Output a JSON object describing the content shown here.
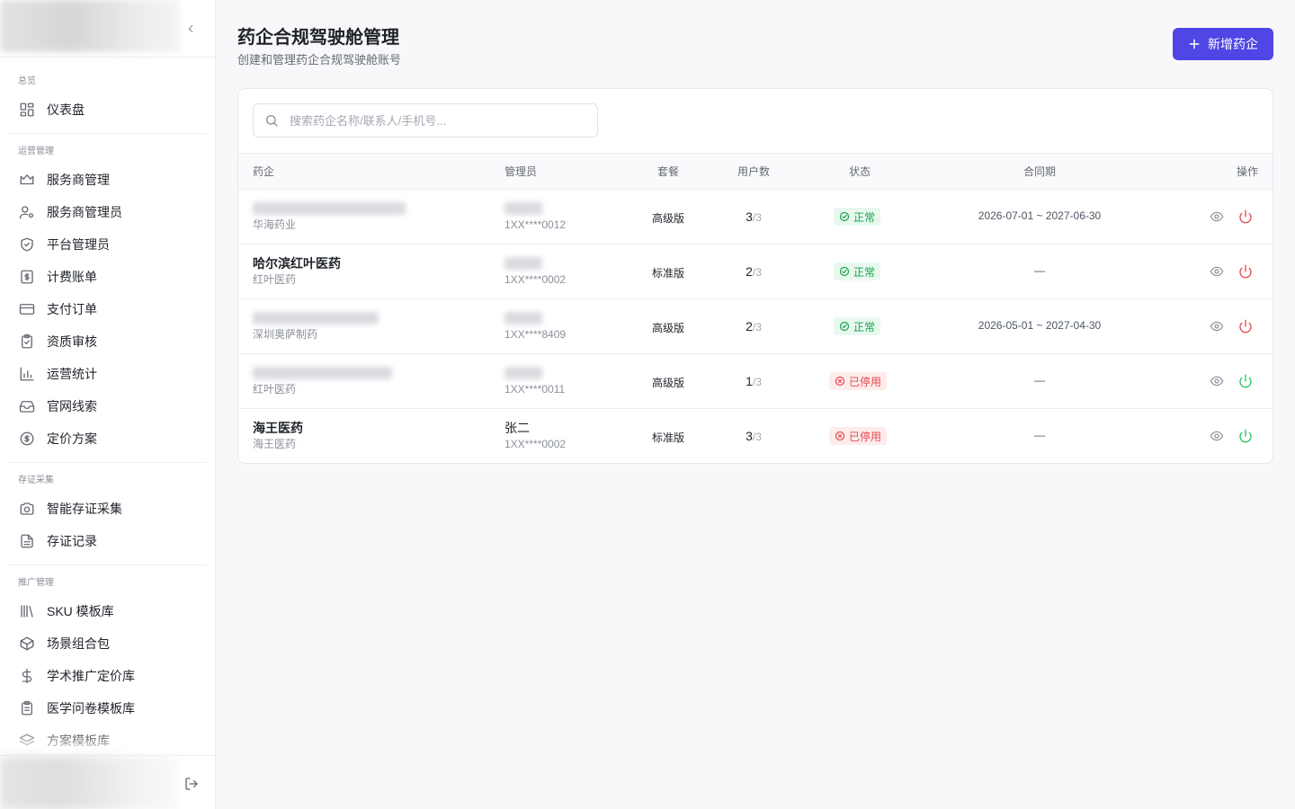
{
  "sidebar": {
    "sections": [
      {
        "title": "总览",
        "items": [
          {
            "label": "仪表盘",
            "icon": "dashboard-icon"
          }
        ]
      },
      {
        "title": "运营管理",
        "items": [
          {
            "label": "服务商管理",
            "icon": "crown-icon"
          },
          {
            "label": "服务商管理员",
            "icon": "user-cog-icon"
          },
          {
            "label": "平台管理员",
            "icon": "shield-check-icon"
          },
          {
            "label": "计费账单",
            "icon": "receipt-dollar-icon"
          },
          {
            "label": "支付订单",
            "icon": "credit-card-icon"
          },
          {
            "label": "资质审核",
            "icon": "clipboard-check-icon"
          },
          {
            "label": "运营统计",
            "icon": "bar-chart-icon"
          },
          {
            "label": "官网线索",
            "icon": "inbox-icon"
          },
          {
            "label": "定价方案",
            "icon": "dollar-circle-icon"
          }
        ]
      },
      {
        "title": "存证采集",
        "items": [
          {
            "label": "智能存证采集",
            "icon": "camera-icon"
          },
          {
            "label": "存证记录",
            "icon": "file-text-icon"
          }
        ]
      },
      {
        "title": "推广管理",
        "items": [
          {
            "label": "SKU 模板库",
            "icon": "library-icon"
          },
          {
            "label": "场景组合包",
            "icon": "package-icon"
          },
          {
            "label": "学术推广定价库",
            "icon": "dollar-sign-icon"
          },
          {
            "label": "医学问卷模板库",
            "icon": "clipboard-list-icon"
          },
          {
            "label": "方案模板库",
            "icon": "layers-icon"
          }
        ]
      }
    ]
  },
  "header": {
    "title": "药企合规驾驶舱管理",
    "subtitle": "创建和管理药企合规驾驶舱账号",
    "add_button": "新增药企"
  },
  "search": {
    "placeholder": "搜索药企名称/联系人/手机号..."
  },
  "table": {
    "columns": [
      "药企",
      "管理员",
      "套餐",
      "用户数",
      "状态",
      "合同期",
      "操作"
    ],
    "rows": [
      {
        "company": "",
        "company_sub": "华海药业",
        "admin": "",
        "phone": "1XX****0012",
        "plan": "高级版",
        "users": "3",
        "users_total": "/3",
        "status": "正常",
        "status_type": "ok",
        "period": "2026-07-01 ~ 2027-06-30",
        "power_color": "#e5484d"
      },
      {
        "company": "哈尔滨红叶医药",
        "company_sub": "红叶医药",
        "admin": "",
        "phone": "1XX****0002",
        "plan": "标准版",
        "users": "2",
        "users_total": "/3",
        "status": "正常",
        "status_type": "ok",
        "period": "—",
        "power_color": "#e5484d"
      },
      {
        "company": "",
        "company_sub": "深圳奥萨制药",
        "admin": "",
        "phone": "1XX****8409",
        "plan": "高级版",
        "users": "2",
        "users_total": "/3",
        "status": "正常",
        "status_type": "ok",
        "period": "2026-05-01 ~ 2027-04-30",
        "power_color": "#e5484d"
      },
      {
        "company": "",
        "company_sub": "红叶医药",
        "admin": "",
        "phone": "1XX****0011",
        "plan": "高级版",
        "users": "1",
        "users_total": "/3",
        "status": "已停用",
        "status_type": "off",
        "period": "—",
        "power_color": "#22c55e"
      },
      {
        "company": "海王医药",
        "company_sub": "海王医药",
        "admin": "张二",
        "phone": "1XX****0002",
        "plan": "标准版",
        "users": "3",
        "users_total": "/3",
        "status": "已停用",
        "status_type": "off",
        "period": "—",
        "power_color": "#22c55e"
      }
    ]
  },
  "colors": {
    "accent": "#4f46e5",
    "ok": "#16a34a",
    "danger": "#e5484d",
    "enable": "#22c55e"
  }
}
